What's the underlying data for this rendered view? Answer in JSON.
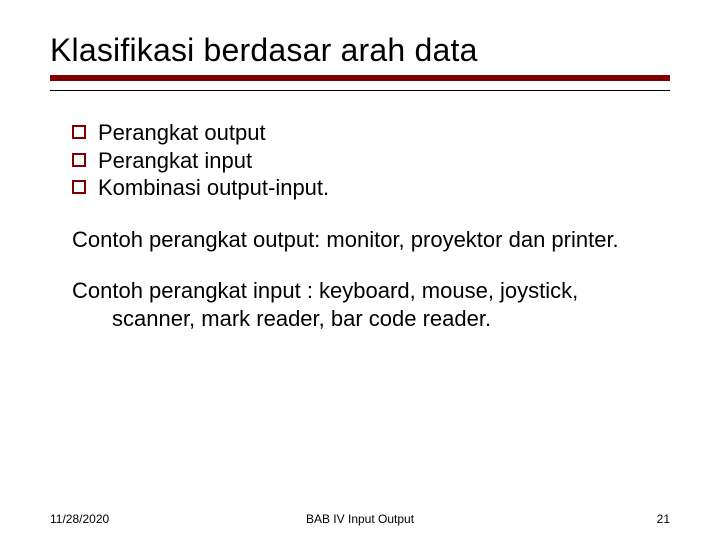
{
  "title": "Klasifikasi berdasar arah data",
  "bullets": {
    "b0": "Perangkat output",
    "b1": "Perangkat input",
    "b2": "Kombinasi output-input."
  },
  "para1": "Contoh perangkat output: monitor, proyektor dan printer.",
  "para2": "Contoh perangkat input : keyboard, mouse, joystick, scanner, mark reader, bar code reader.",
  "footer": {
    "date": "11/28/2020",
    "center": "BAB IV   Input Output",
    "page": "21"
  }
}
